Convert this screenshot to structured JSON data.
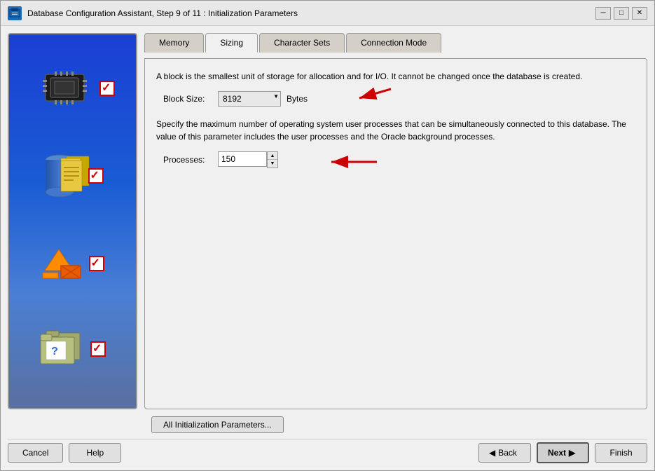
{
  "window": {
    "title": "Database Configuration Assistant, Step 9 of 11 : Initialization Parameters",
    "icon": "DB"
  },
  "tabs": [
    {
      "id": "memory",
      "label": "Memory",
      "active": false
    },
    {
      "id": "sizing",
      "label": "Sizing",
      "active": true
    },
    {
      "id": "character-sets",
      "label": "Character Sets",
      "active": false
    },
    {
      "id": "connection-mode",
      "label": "Connection Mode",
      "active": false
    }
  ],
  "sizing": {
    "block_size_description": "A block is the smallest unit of storage for allocation and for I/O. It cannot be changed once the database is created.",
    "block_size_label": "Block Size:",
    "block_size_value": "8192",
    "block_size_unit": "Bytes",
    "processes_description": "Specify the maximum number of operating system user processes that can be simultaneously connected to this database. The value of this parameter includes the user processes and the Oracle background processes.",
    "processes_label": "Processes:",
    "processes_value": "150"
  },
  "buttons": {
    "all_init_params": "All Initialization Parameters...",
    "cancel": "Cancel",
    "help": "Help",
    "back": "Back",
    "next": "Next",
    "finish": "Finish"
  }
}
